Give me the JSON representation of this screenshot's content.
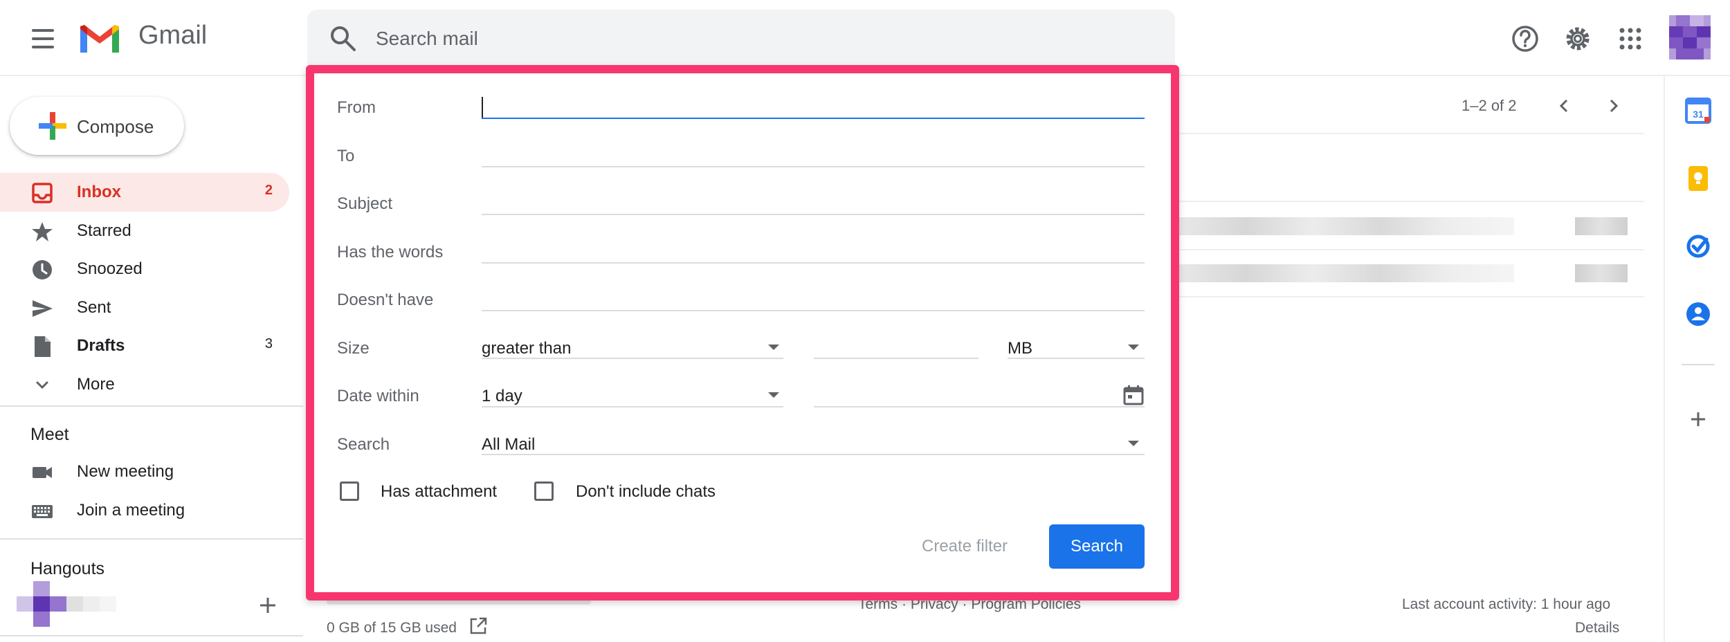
{
  "app": {
    "name": "Gmail"
  },
  "search": {
    "placeholder": "Search mail"
  },
  "compose": {
    "label": "Compose"
  },
  "nav": {
    "items": [
      {
        "label": "Inbox",
        "count": "2"
      },
      {
        "label": "Starred",
        "count": ""
      },
      {
        "label": "Snoozed",
        "count": ""
      },
      {
        "label": "Sent",
        "count": ""
      },
      {
        "label": "Drafts",
        "count": "3"
      },
      {
        "label": "More",
        "count": ""
      }
    ]
  },
  "meet": {
    "title": "Meet",
    "new_meeting": "New meeting",
    "join_meeting": "Join a meeting"
  },
  "hangouts": {
    "title": "Hangouts"
  },
  "mail_list": {
    "pager": "1–2 of 2"
  },
  "advanced_search": {
    "fields": {
      "from": "From",
      "to": "To",
      "subject": "Subject",
      "has_words": "Has the words",
      "doesnt_have": "Doesn't have",
      "size": "Size",
      "date_within": "Date within",
      "search": "Search"
    },
    "size_operator": "greater than",
    "size_unit": "MB",
    "date_within_value": "1 day",
    "search_in": "All Mail",
    "has_attachment": "Has attachment",
    "dont_include_chats": "Don't include chats",
    "create_filter": "Create filter",
    "search_button": "Search"
  },
  "footer": {
    "storage": "0 GB of 15 GB used",
    "links": "Terms · Privacy · Program Policies",
    "last_activity": "Last account activity: 1 hour ago",
    "details": "Details"
  },
  "colors": {
    "accent": "#1a73e8",
    "inbox_red": "#d93025",
    "highlight_border": "#f7366f"
  },
  "icons": [
    "menu-icon",
    "gmail-logo-icon",
    "search-icon",
    "help-icon",
    "settings-icon",
    "apps-icon",
    "calendar-app-icon",
    "keep-app-icon",
    "tasks-app-icon",
    "contacts-app-icon",
    "add-icon"
  ]
}
